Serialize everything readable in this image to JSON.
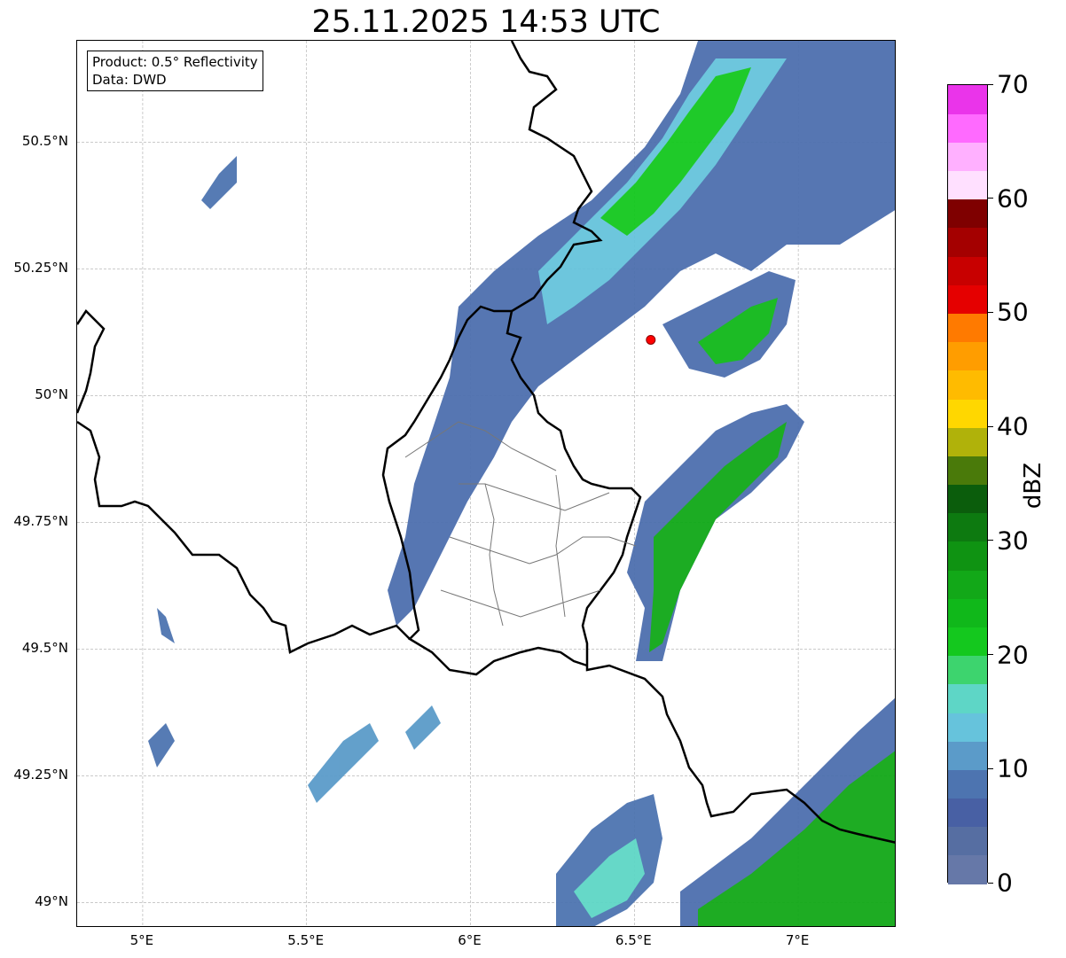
{
  "title": "25.11.2025 14:53 UTC",
  "info": {
    "product": "Product: 0.5° Reflectivity",
    "data": "Data: DWD"
  },
  "axes": {
    "lat_ticks": [
      "50.5°N",
      "50.25°N",
      "50°N",
      "49.75°N",
      "49.5°N",
      "49.25°N",
      "49°N"
    ],
    "lon_ticks": [
      "5°E",
      "5.5°E",
      "6°E",
      "6.5°E",
      "7°E"
    ],
    "lat_range": [
      48.95,
      50.7
    ],
    "lon_range": [
      4.8,
      7.3
    ],
    "grid": true
  },
  "colorbar": {
    "unit": "dBZ",
    "tick_labels": [
      "0",
      "10",
      "20",
      "30",
      "40",
      "50",
      "60",
      "70"
    ],
    "range": [
      0,
      70
    ],
    "colors": [
      "#6678a8",
      "#566ea2",
      "#4860a4",
      "#4d74b0",
      "#5b9bc9",
      "#66c3dc",
      "#5ed6c6",
      "#3dd46e",
      "#14c81e",
      "#10b81a",
      "#12a818",
      "#0f9312",
      "#0d7a10",
      "#0b5d0c",
      "#4a7a0a",
      "#b0b20a",
      "#ffd700",
      "#ffbb00",
      "#ff9d00",
      "#ff7a00",
      "#e50000",
      "#c80000",
      "#a40000",
      "#7f0000",
      "#ffe0ff",
      "#ffb0ff",
      "#ff6aff",
      "#ea34ea"
    ]
  },
  "marker": {
    "lon": 6.55,
    "lat": 50.11,
    "color": "#ff0000"
  }
}
